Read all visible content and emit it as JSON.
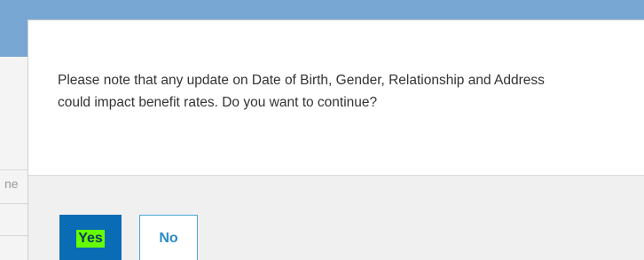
{
  "background": {
    "partial_label": "ne"
  },
  "dialog": {
    "message": "Please note that any update on Date of Birth, Gender, Relationship and Address\ncould impact benefit rates. Do you want to continue?",
    "yes_label": "Yes",
    "no_label": "No"
  },
  "colors": {
    "header_blue": "#79a7d3",
    "primary_button": "#0a6cb4",
    "highlight": "#66ff00",
    "secondary_border": "#4fa6d4"
  }
}
